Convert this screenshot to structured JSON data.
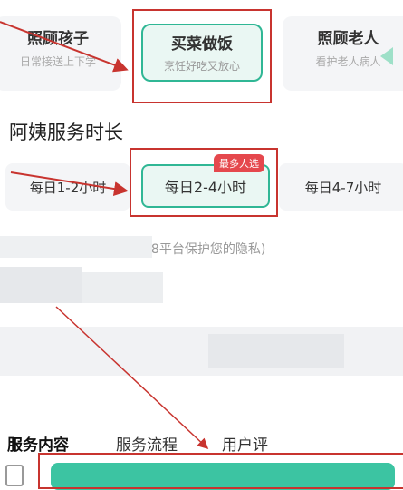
{
  "service_types": [
    {
      "title": "照顾孩子",
      "desc": "日常接送上下学",
      "selected": false
    },
    {
      "title": "买菜做饭",
      "desc": "烹饪好吃又放心",
      "selected": true
    },
    {
      "title": "照顾老人",
      "desc": "看护老人病人",
      "selected": false
    }
  ],
  "duration_heading": "阿姨服务时长",
  "duration_options": [
    {
      "label": "每日1-2小时",
      "selected": false
    },
    {
      "label": "每日2-4小时",
      "selected": true,
      "badge": "最多人选"
    },
    {
      "label": "每日4-7小时",
      "selected": false
    }
  ],
  "privacy_note_visible": "服务 ... 保护您的隐私)",
  "privacy_note_fragment": "58平台保护您的隐私)",
  "bottom_tabs": [
    {
      "label": "服务内容",
      "active": true
    },
    {
      "label": "服务流程",
      "active": false
    },
    {
      "label": "用户评",
      "active": false
    }
  ],
  "colors": {
    "accent": "#30b795",
    "annotation_red": "#c8342f",
    "badge_red": "#e5484d"
  }
}
